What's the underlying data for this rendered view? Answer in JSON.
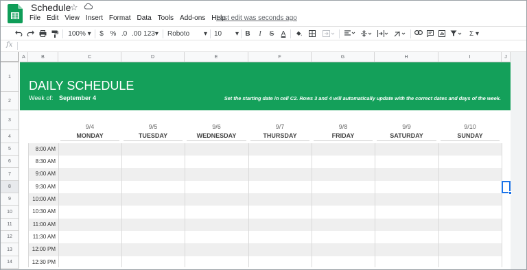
{
  "app": {
    "title": "Schedule",
    "menu": [
      "File",
      "Edit",
      "View",
      "Insert",
      "Format",
      "Data",
      "Tools",
      "Add-ons",
      "Help"
    ],
    "last_edit": "Last edit was seconds ago",
    "colors": {
      "sheets_green": "#0f9d58",
      "banner_green": "#14a05a",
      "selection_blue": "#1a73e8"
    }
  },
  "toolbar": {
    "zoom": "100%",
    "currency": "$",
    "percent": "%",
    "decimal_decrease": ".0",
    "decimal_increase": ".00",
    "more_formats": "123",
    "font": "Roboto",
    "font_size": "10",
    "bold": "B",
    "italic": "I",
    "strikethrough": "S",
    "text_color": "A",
    "function": "Σ",
    "icons": [
      "undo-icon",
      "redo-icon",
      "print-icon",
      "paint-format-icon",
      "fill-color-icon",
      "borders-icon",
      "merge-cells-icon",
      "align-left-icon",
      "vertical-align-icon",
      "wrap-icon",
      "rotate-icon",
      "link-icon",
      "comment-icon",
      "chart-icon",
      "filter-icon",
      "function-icon",
      "more-icon"
    ]
  },
  "formula_bar": {
    "label": "fx",
    "value": ""
  },
  "columns": [
    "A",
    "B",
    "C",
    "D",
    "E",
    "F",
    "G",
    "H",
    "I",
    "J"
  ],
  "rows": [
    "1",
    "2",
    "3",
    "4",
    "5",
    "6",
    "7",
    "8",
    "9",
    "10",
    "11",
    "12",
    "13",
    "14"
  ],
  "banner": {
    "title": "DAILY SCHEDULE",
    "week_of_label": "Week of:",
    "week_of_value": "September 4",
    "note": "Set the starting date in cell C2. Rows 3 and 4 will automatically update with the correct dates and days of the week."
  },
  "days": [
    {
      "date": "9/4",
      "name": "MONDAY"
    },
    {
      "date": "9/5",
      "name": "TUESDAY"
    },
    {
      "date": "9/6",
      "name": "WEDNESDAY"
    },
    {
      "date": "9/7",
      "name": "THURSDAY"
    },
    {
      "date": "9/8",
      "name": "FRIDAY"
    },
    {
      "date": "9/9",
      "name": "SATURDAY"
    },
    {
      "date": "9/10",
      "name": "SUNDAY"
    }
  ],
  "times": [
    "8:00 AM",
    "8:30 AM",
    "9:00 AM",
    "9:30 AM",
    "10:00 AM",
    "10:30 AM",
    "11:00 AM",
    "11:30 AM",
    "12:00 PM",
    "12:30 PM"
  ]
}
